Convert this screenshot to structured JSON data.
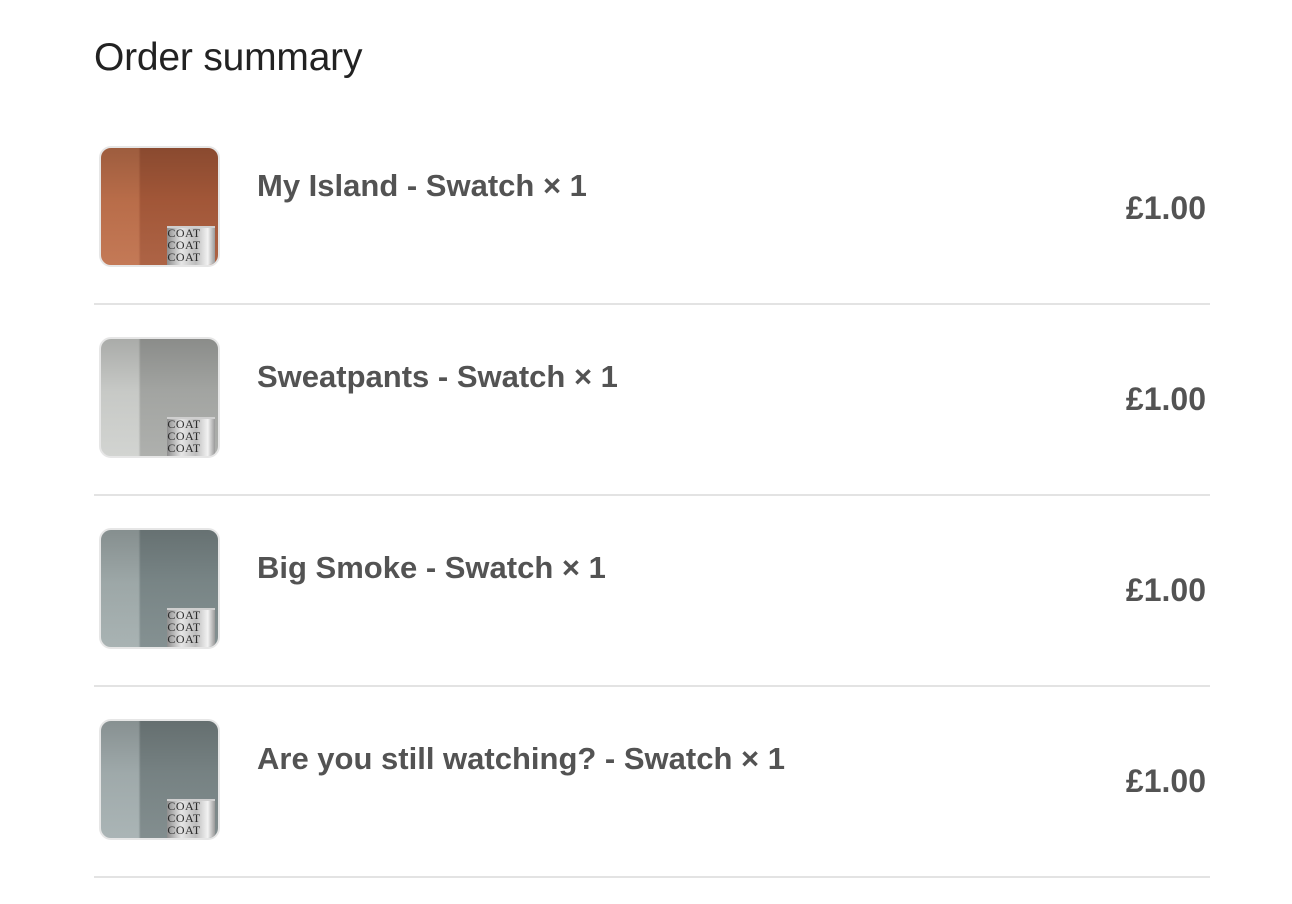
{
  "title": "Order summary",
  "items": [
    {
      "name": "My Island - Swatch × 1",
      "price": "£1.00",
      "thumb_colors": [
        "#a85a3a",
        "#c0714c"
      ],
      "can_text": "COAT"
    },
    {
      "name": "Sweatpants - Swatch × 1",
      "price": "£1.00",
      "thumb_colors": [
        "#a9aba8",
        "#cfd1ce"
      ],
      "can_text": "COAT"
    },
    {
      "name": "Big Smoke - Swatch × 1",
      "price": "£1.00",
      "thumb_colors": [
        "#7d8a8b",
        "#a3aeae"
      ],
      "can_text": "COAT"
    },
    {
      "name": "Are you still watching? - Swatch × 1",
      "price": "£1.00",
      "thumb_colors": [
        "#7b8788",
        "#a5b0b1"
      ],
      "can_text": "COAT"
    }
  ]
}
